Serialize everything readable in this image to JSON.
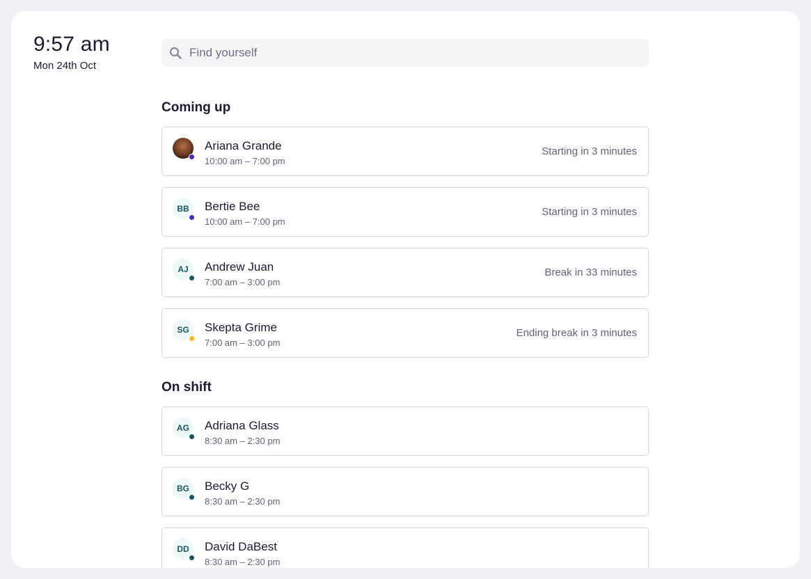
{
  "clock": {
    "time": "9:57 am",
    "date": "Mon 24th Oct"
  },
  "search": {
    "placeholder": "Find yourself",
    "value": "",
    "icon": "search-icon"
  },
  "colors": {
    "status_purple": "#4b2bbd",
    "status_green": "#17575d",
    "status_yellow": "#f5b919"
  },
  "coming_up": {
    "title": "Coming up",
    "items": [
      {
        "name": "Ariana Grande",
        "initials": "",
        "shift": "10:00 am – 7:00 pm",
        "status": "Starting in 3 minutes",
        "dot": "#4b2bbd",
        "photo": true
      },
      {
        "name": "Bertie Bee",
        "initials": "BB",
        "shift": "10:00 am – 7:00 pm",
        "status": "Starting in 3 minutes",
        "dot": "#4b2bbd",
        "photo": false
      },
      {
        "name": "Andrew Juan",
        "initials": "AJ",
        "shift": "7:00 am – 3:00 pm",
        "status": "Break in 33 minutes",
        "dot": "#17575d",
        "photo": false
      },
      {
        "name": "Skepta Grime",
        "initials": "SG",
        "shift": "7:00 am – 3:00 pm",
        "status": "Ending break in 3 minutes",
        "dot": "#f5b919",
        "photo": false
      }
    ]
  },
  "on_shift": {
    "title": "On shift",
    "items": [
      {
        "name": "Adriana Glass",
        "initials": "AG",
        "shift": "8:30 am – 2:30 pm",
        "status": "",
        "dot": "#17575d",
        "photo": false
      },
      {
        "name": "Becky G",
        "initials": "BG",
        "shift": "8:30 am – 2:30 pm",
        "status": "",
        "dot": "#17575d",
        "photo": false
      },
      {
        "name": "David DaBest",
        "initials": "DD",
        "shift": "8:30 am – 2:30 pm",
        "status": "",
        "dot": "#17575d",
        "photo": false
      }
    ]
  }
}
